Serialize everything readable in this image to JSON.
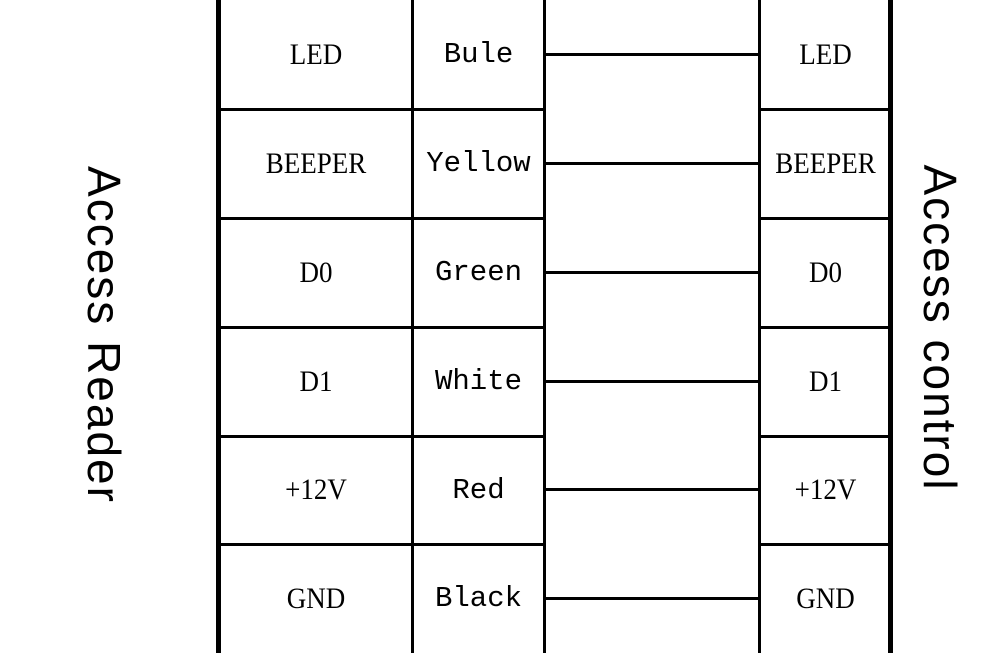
{
  "left_device": {
    "label": "Access Reader"
  },
  "right_device": {
    "label": "Access control"
  },
  "rows": [
    {
      "signal": "LED",
      "wire_color": "Bule",
      "controller_terminal": "LED"
    },
    {
      "signal": "BEEPER",
      "wire_color": "Yellow",
      "controller_terminal": "BEEPER"
    },
    {
      "signal": "D0",
      "wire_color": "Green",
      "controller_terminal": "D0"
    },
    {
      "signal": "D1",
      "wire_color": "White",
      "controller_terminal": "D1"
    },
    {
      "signal": "+12V",
      "wire_color": "Red",
      "controller_terminal": "+12V"
    },
    {
      "signal": "GND",
      "wire_color": "Black",
      "controller_terminal": "GND"
    }
  ]
}
